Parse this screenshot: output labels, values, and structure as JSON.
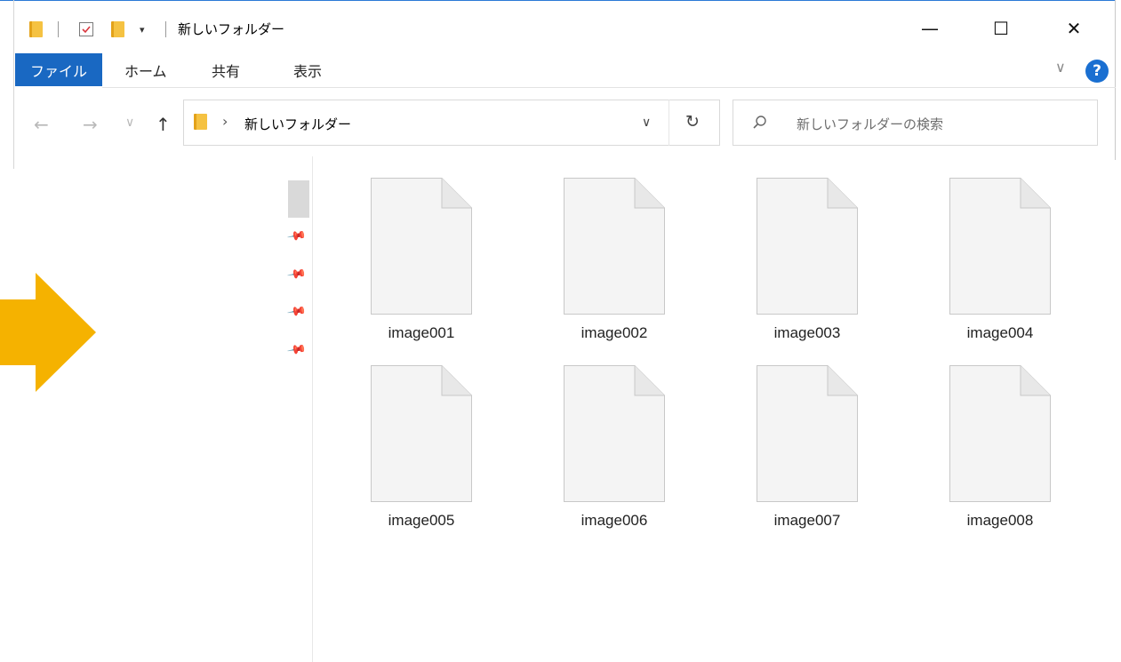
{
  "window": {
    "title": "新しいフォルダー",
    "controls": {
      "minimize": "—",
      "maximize": "☐",
      "close": "✕"
    }
  },
  "ribbon": {
    "tabs": [
      {
        "label": "ファイル",
        "active": true
      },
      {
        "label": "ホーム"
      },
      {
        "label": "共有"
      },
      {
        "label": "表示"
      }
    ],
    "help": "?"
  },
  "nav": {
    "back": "←",
    "forward": "→",
    "recent": "∨",
    "up": "↑",
    "breadcrumb": [
      "新しいフォルダー"
    ],
    "breadcrumb_sep": "›",
    "dropdown": "∨",
    "refresh": "↻"
  },
  "search": {
    "placeholder": "新しいフォルダーの検索",
    "icon": "search-icon"
  },
  "files": [
    {
      "name": "image001"
    },
    {
      "name": "image002"
    },
    {
      "name": "image003"
    },
    {
      "name": "image004"
    },
    {
      "name": "image005"
    },
    {
      "name": "image006"
    },
    {
      "name": "image007"
    },
    {
      "name": "image008"
    }
  ],
  "colors": {
    "accent": "#1968c2",
    "arrow": "#f5b200",
    "folder": "#f5c242"
  }
}
